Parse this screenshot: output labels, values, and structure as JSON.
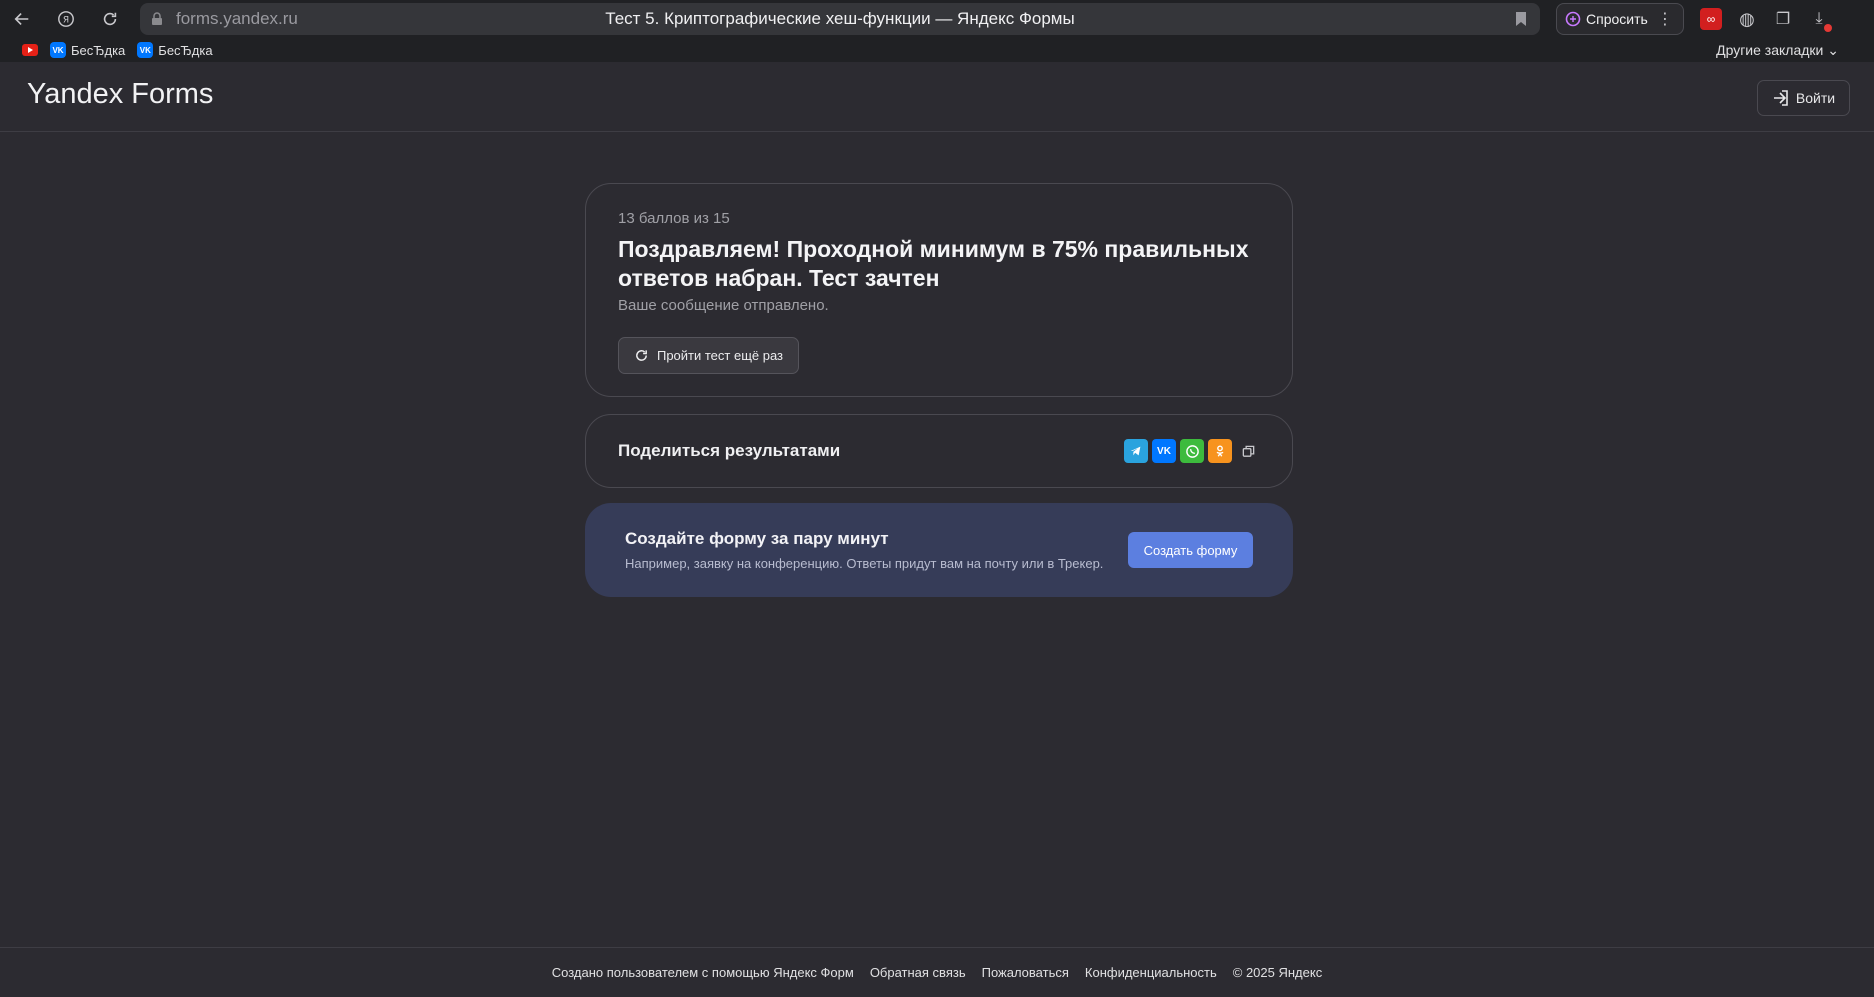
{
  "browser": {
    "url": "forms.yandex.ru",
    "tab_title": "Тест 5. Криптографические хеш-функции — Яндекс Формы",
    "ask_label": "Спросить",
    "bookmarks": [
      {
        "label": "",
        "icon": "youtube-icon"
      },
      {
        "label": "БесЂдка",
        "icon": "vk-icon"
      },
      {
        "label": "БесЂдка",
        "icon": "vk-icon"
      }
    ],
    "other_bookmarks": "Другие закладки"
  },
  "header": {
    "logo": "Yandex Forms",
    "login_label": "Войти"
  },
  "result": {
    "score": "13 баллов из 15",
    "title": "Поздравляем! Проходной минимум в 75% правильных ответов набран. Тест зачтен",
    "message": "Ваше сообщение отправлено.",
    "retry_label": "Пройти тест ещё раз"
  },
  "share": {
    "label": "Поделиться результатами",
    "icons": [
      "telegram-icon",
      "vk-icon",
      "whatsapp-icon",
      "odnoklassniki-icon",
      "copy-icon"
    ]
  },
  "promo": {
    "title": "Создайте форму за пару минут",
    "subtitle": "Например, заявку на конференцию. Ответы придут вам на почту или в Трекер.",
    "button_label": "Создать форму"
  },
  "footer": {
    "created_by": "Создано пользователем с помощью Яндекс Форм",
    "feedback": "Обратная связь",
    "report": "Пожаловаться",
    "privacy": "Конфиденциальность",
    "copyright": "© 2025 Яндекс"
  },
  "colors": {
    "background": "#2c2b31",
    "promo_bg": "#363c58",
    "primary_button": "#5c7fe0"
  }
}
